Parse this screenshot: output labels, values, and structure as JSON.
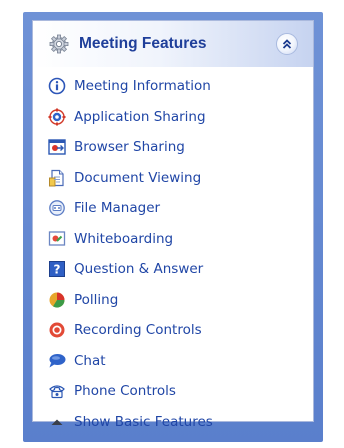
{
  "panel": {
    "title": "Meeting Features",
    "header_icon": "gear-icon",
    "collapse_icon": "double-chevron-up-icon"
  },
  "items": [
    {
      "label": "Meeting Information",
      "icon": "info-icon"
    },
    {
      "label": "Application Sharing",
      "icon": "app-sharing-icon"
    },
    {
      "label": "Browser Sharing",
      "icon": "browser-sharing-icon"
    },
    {
      "label": "Document Viewing",
      "icon": "document-icon"
    },
    {
      "label": "File Manager",
      "icon": "file-manager-icon"
    },
    {
      "label": "Whiteboarding",
      "icon": "whiteboard-icon"
    },
    {
      "label": "Question & Answer",
      "icon": "question-icon"
    },
    {
      "label": "Polling",
      "icon": "pie-chart-icon"
    },
    {
      "label": "Recording Controls",
      "icon": "record-icon"
    },
    {
      "label": "Chat",
      "icon": "chat-bubble-icon"
    },
    {
      "label": "Phone Controls",
      "icon": "phone-icon"
    },
    {
      "label": "Show Basic Features",
      "icon": "triangle-up-icon"
    }
  ],
  "colors": {
    "frame": "#5f84d0",
    "text": "#2046a6",
    "title": "#1f3f9a"
  }
}
